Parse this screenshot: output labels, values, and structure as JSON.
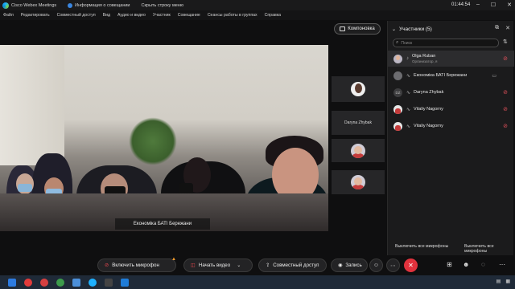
{
  "titlebar": {
    "app_name": "Cisco Webex Meetings",
    "meeting_info": "Информация о совещании",
    "hide_menu": "Скрыть строку меню",
    "clock": "01:44:54"
  },
  "menu": [
    "Файл",
    "Редактировать",
    "Совместный доступ",
    "Вид",
    "Аудио и видео",
    "Участник",
    "Совещание",
    "Сеансы работы в группах",
    "Справка"
  ],
  "stage": {
    "layout_button": "Компоновка",
    "main_video_name": "Економіка БАТІ Бережани",
    "thumbnails": [
      {
        "name": "",
        "avatar": "lady"
      },
      {
        "name": "Daryna Zhybak",
        "avatar": "none"
      },
      {
        "name": "",
        "avatar": "face"
      },
      {
        "name": "",
        "avatar": "face"
      }
    ]
  },
  "participants": {
    "title": "Участники (5)",
    "search_placeholder": "Поиск",
    "list": [
      {
        "name": "Olga Ruban",
        "role": "Организатор, я",
        "avatar": "photo",
        "mic_muted": true,
        "selected": true
      },
      {
        "name": "Економіка БАТІ Бережани",
        "role": "",
        "avatar": "grey",
        "camera": true,
        "mic_muted": false
      },
      {
        "name": "Daryna Zhybak",
        "role": "",
        "avatar": "init",
        "initials": "DZ",
        "mic_muted": true
      },
      {
        "name": "Vitaliy Nagorny",
        "role": "",
        "avatar": "photo2",
        "mic_muted": true
      },
      {
        "name": "Vitaliy Nagorny",
        "role": "",
        "avatar": "photo2",
        "mic_muted": true
      }
    ],
    "mute_all_left": "Выключить все микрофоны",
    "mute_all_right": "Выключить все микрофоны"
  },
  "controls": {
    "unmute": "Включить микрофон",
    "start_video": "Начать видео",
    "share": "Совместный доступ",
    "record": "Запись"
  },
  "colors": {
    "end_call": "#e0323d",
    "muted_red": "#e6474f",
    "panel_bg": "#1b1b1c"
  }
}
